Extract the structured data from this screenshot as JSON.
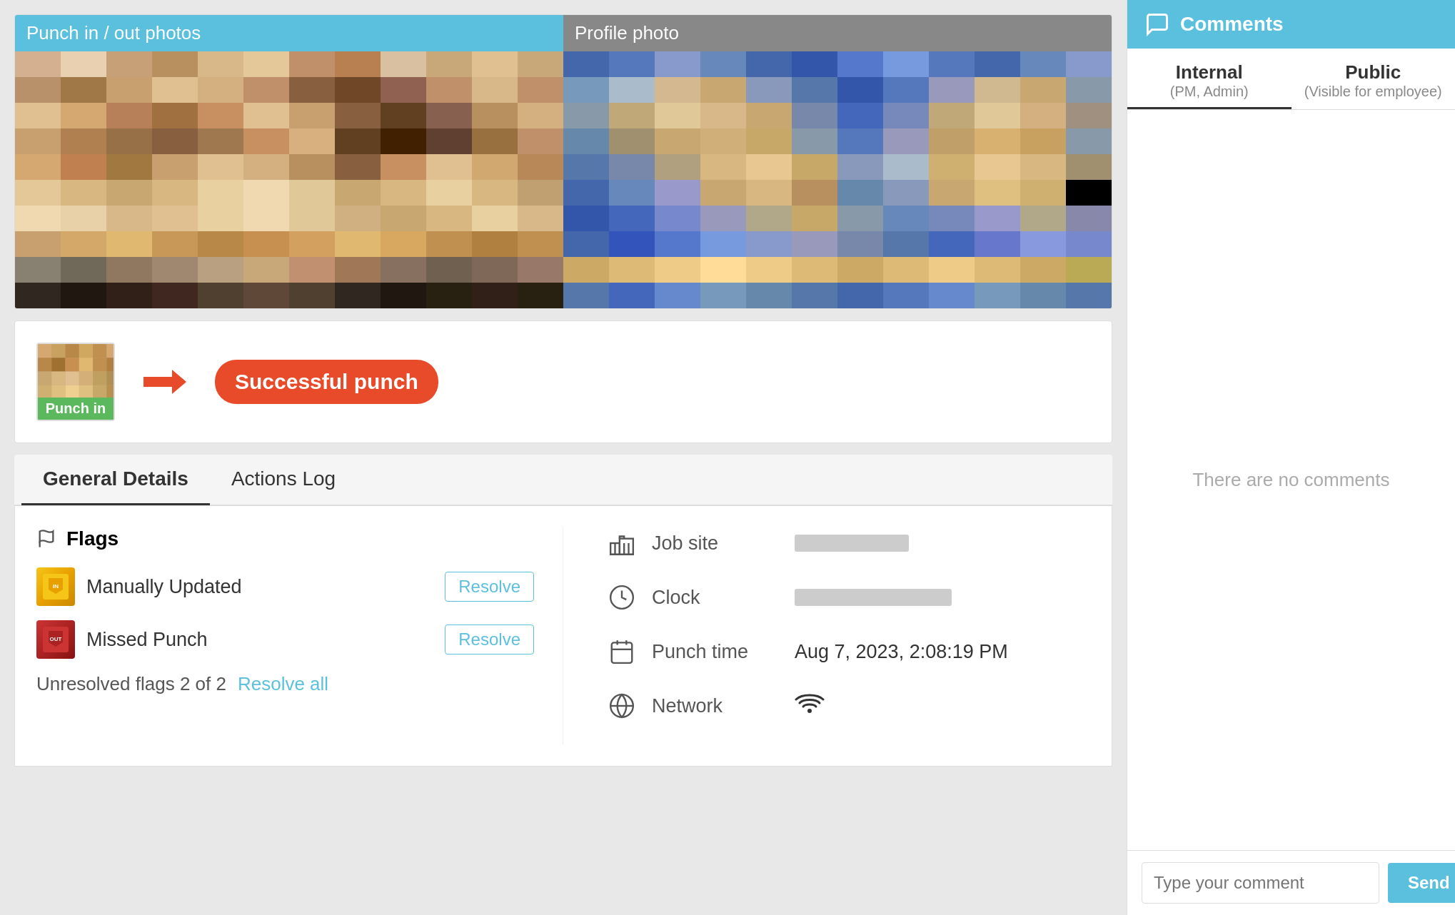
{
  "photos": {
    "punch_label": "Punch in / out photos",
    "profile_label": "Profile photo"
  },
  "punch": {
    "badge_text": "Punch in",
    "successful_punch": "Successful punch"
  },
  "tabs": {
    "general_details": "General Details",
    "actions_log": "Actions Log"
  },
  "flags": {
    "header": "Flags",
    "items": [
      {
        "name": "Manually Updated",
        "type": "manually-updated"
      },
      {
        "name": "Missed Punch",
        "type": "missed-punch"
      }
    ],
    "resolve_label": "Resolve",
    "unresolved_text": "Unresolved flags 2 of 2",
    "resolve_all_label": "Resolve all"
  },
  "details": {
    "job_site_label": "Job site",
    "clock_label": "Clock",
    "punch_time_label": "Punch time",
    "punch_time_value": "Aug 7, 2023, 2:08:19 PM",
    "network_label": "Network"
  },
  "comments": {
    "header": "Comments",
    "tab_internal_title": "Internal",
    "tab_internal_subtitle": "(PM, Admin)",
    "tab_public_title": "Public",
    "tab_public_subtitle": "(Visible for employee)",
    "empty_text": "There are no comments",
    "input_placeholder": "Type your comment",
    "send_label": "Send"
  },
  "colors": {
    "accent_blue": "#5bc0de",
    "red_orange": "#e84b2a",
    "green": "#5cb85c",
    "dark_underline": "#333"
  }
}
